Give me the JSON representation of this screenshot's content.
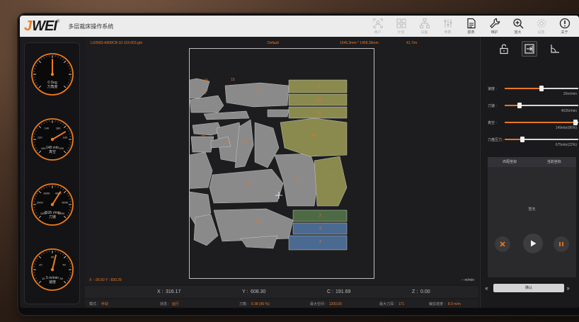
{
  "logo": {
    "j": "J",
    "wei": "WEI",
    "reg": "®"
  },
  "app_title": "多层裁床操作系统",
  "toolbar": [
    {
      "icon": "user-scan-icon",
      "label": "用户",
      "enabled": false
    },
    {
      "icon": "grid-icon",
      "label": "计划",
      "enabled": false
    },
    {
      "icon": "network-icon",
      "label": "设备",
      "enabled": false
    },
    {
      "icon": "sliders-icon",
      "label": "参数",
      "enabled": false
    },
    {
      "icon": "report-icon",
      "label": "报表",
      "enabled": true
    },
    {
      "icon": "wrench-icon",
      "label": "维护",
      "enabled": true
    },
    {
      "icon": "zoom-in-icon",
      "label": "放大",
      "enabled": true
    },
    {
      "icon": "gear-icon",
      "label": "设置",
      "enabled": false
    },
    {
      "icon": "info-icon",
      "label": "关于",
      "enabled": true
    }
  ],
  "gauges": [
    {
      "name": "angle-gauge",
      "value_text": "0 Deg",
      "caption": "刀角度",
      "ticks": [
        "",
        "",
        "",
        "",
        "",
        "",
        "",
        "",
        ""
      ],
      "needle": 0.5
    },
    {
      "name": "pressure-gauge",
      "value_text": "148 mbr",
      "caption": "真空",
      "ticks": [
        "100",
        "120",
        "140",
        "160",
        "180",
        "200"
      ],
      "needle": 0.72
    },
    {
      "name": "speed-gauge",
      "value_text": "4535 r/min",
      "caption": "刀速",
      "ticks": [
        "1000",
        "2000",
        "3000",
        "4000",
        "5000",
        "6000"
      ],
      "needle": 0.62
    },
    {
      "name": "feed-gauge",
      "value_text": "5 m/min",
      "caption": "速度",
      "ticks": [
        "10",
        "20",
        "30",
        "40",
        "50"
      ],
      "needle": 0.55
    }
  ],
  "canvas": {
    "filename": "LU0583-A068CB-10-119-003.gbr",
    "mode": "Default",
    "dimensions": "1645.3mm * 1458.39mm",
    "length": "41.7/m",
    "cursor_pos": "X : -36.50   Y : 830.29",
    "speed_unit": "-- m/min",
    "colors": {
      "accent": "#e87722",
      "piece_gray": "#8a8a8a",
      "piece_olive": "#8b8a4e",
      "piece_green": "#4d6a45",
      "piece_blue": "#4b6a92"
    },
    "piece_numbers": [
      "44",
      "15",
      "16",
      "43",
      "11",
      "12",
      "13",
      "14",
      "17",
      "18",
      "20",
      "21",
      "22",
      "23",
      "24",
      "25",
      "26",
      "27",
      "28",
      "29",
      "30",
      "31",
      "32",
      "33",
      "34",
      "35",
      "36",
      "37",
      "38",
      "39",
      "40",
      "41",
      "42",
      "1",
      "2",
      "3",
      "4",
      "5",
      "6",
      "7",
      "8",
      "9",
      "10"
    ]
  },
  "coords": {
    "x_label": "X :",
    "x": "316.17",
    "y_label": "Y :",
    "y": "608.30",
    "c_label": "C :",
    "c": "191.69",
    "z_label": "Z :",
    "z": "0.00"
  },
  "status": [
    {
      "label": "模式 :",
      "value": "手动"
    },
    {
      "label": "状态 :",
      "value": "运行"
    },
    {
      "label": "刀角 :",
      "value": "0.38 (96 %)"
    },
    {
      "label": "最大空间 :",
      "value": "1200.00"
    },
    {
      "label": "最大刀深 :",
      "value": "171"
    },
    {
      "label": "裁剪进度 :",
      "value": "8.0 m/m"
    }
  ],
  "right_tabs": [
    {
      "icon": "unlock-icon",
      "active": false
    },
    {
      "icon": "import-icon",
      "active": true
    },
    {
      "icon": "angle-icon",
      "active": false
    }
  ],
  "sliders": [
    {
      "label": "速度 :",
      "value": "20m/min",
      "fraction": 0.5
    },
    {
      "label": "刀速 :",
      "value": "4526r/min",
      "fraction": 0.2
    },
    {
      "label": "真空 :",
      "value": "149mbr(96%)",
      "fraction": 0.96
    },
    {
      "label": "刀盘压力 :",
      "value": "675mbr(22%)",
      "fraction": 0.24
    }
  ],
  "task_tabs": [
    "匹配坐标",
    "当前坐标"
  ],
  "task_empty": "暂无",
  "confirm_label": "确认"
}
